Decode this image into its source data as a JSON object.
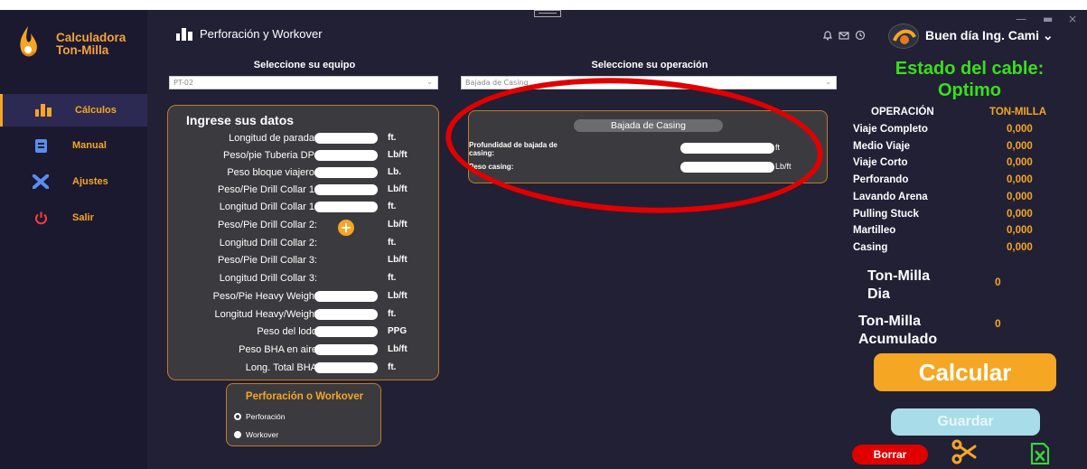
{
  "app": {
    "brand_line1": "Calculadora",
    "brand_line2": "Ton-Milla",
    "page_title": "Perforación y Workover",
    "greeting": "Buen día Ing. Cami",
    "accent": "#f5a623",
    "cable_green": "#39e01b"
  },
  "sidebar": {
    "items": [
      {
        "label": "Cálculos",
        "icon": "drilling-rig-icon"
      },
      {
        "label": "Manual",
        "icon": "book-icon"
      },
      {
        "label": "Ajustes",
        "icon": "tools-icon"
      },
      {
        "label": "Salir",
        "icon": "power-icon"
      }
    ]
  },
  "selectors": {
    "equipo_label": "Seleccione su equipo",
    "equipo_value": "PT-02",
    "operacion_label": "Seleccione su operación",
    "operacion_value": "Bajada de Casing"
  },
  "data_panel": {
    "title": "Ingrese sus datos",
    "fields": [
      {
        "label": "Longitud de parada:",
        "unit": "ft."
      },
      {
        "label": "Peso/pie Tuberia DP:",
        "unit": "Lb/ft"
      },
      {
        "label": "Peso bloque viajero:",
        "unit": "Lb."
      },
      {
        "label": "Peso/Pie Drill Collar 1:",
        "unit": "Lb/ft"
      },
      {
        "label": "Longitud Drill Collar 1:",
        "unit": "ft."
      },
      {
        "label": "Peso/Pie Drill Collar 2:",
        "unit": "Lb/ft"
      },
      {
        "label": "Longitud Drill Collar 2:",
        "unit": "ft."
      },
      {
        "label": "Peso/Pie Drill Collar 3:",
        "unit": "Lb/ft"
      },
      {
        "label": "Longitud Drill Collar 3:",
        "unit": "ft."
      },
      {
        "label": "Peso/Pie Heavy Weight",
        "unit": "Lb/ft"
      },
      {
        "label": "Longitud Heavy/Weight",
        "unit": "ft."
      },
      {
        "label": "Peso del lodo",
        "unit": "PPG"
      },
      {
        "label": "Peso BHA en aire",
        "unit": "Lb/ft"
      },
      {
        "label": "Long. Total BHA",
        "unit": "ft."
      }
    ],
    "add_symbol": "+"
  },
  "mode": {
    "title": "Perforación o Workover",
    "options": [
      "Perforación",
      "Workover"
    ],
    "selected": "Perforación"
  },
  "casing": {
    "title": "Bajada de Casing",
    "depth_label_1": "Profundidad de bajada de",
    "depth_label_2": "casing:",
    "depth_unit": "ft",
    "weight_label": "Peso casing:",
    "weight_unit": "Lb/ft"
  },
  "status": {
    "line1": "Estado del cable:",
    "line2": "Optimo"
  },
  "operations": {
    "col_op": "OPERACIÓN",
    "col_val": "TON-MILLA",
    "rows": [
      {
        "name": "Viaje Completo",
        "value": "0,000"
      },
      {
        "name": "Medio Viaje",
        "value": "0,000"
      },
      {
        "name": "Viaje Corto",
        "value": "0,000"
      },
      {
        "name": "Perforando",
        "value": "0,000"
      },
      {
        "name": "Lavando Arena",
        "value": "0,000"
      },
      {
        "name": "Pulling Stuck",
        "value": "0,000"
      },
      {
        "name": "Martilleo",
        "value": "0,000"
      },
      {
        "name": "Casing",
        "value": "0,000"
      }
    ]
  },
  "totals": {
    "dia_1": "Ton-Milla",
    "dia_2": "Dia",
    "dia_value": "0",
    "acum_1": "Ton-Milla",
    "acum_2": "Acumulado",
    "acum_value": "0"
  },
  "actions": {
    "calcular": "Calcular",
    "guardar": "Guardar",
    "borrar": "Borrar"
  },
  "window": {
    "minimize": "—",
    "maximize": "▬",
    "close": "×"
  }
}
